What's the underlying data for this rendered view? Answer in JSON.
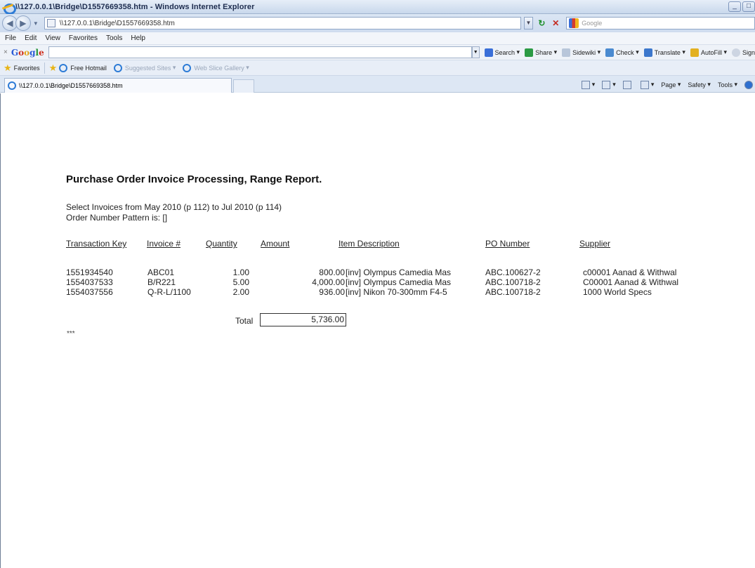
{
  "window": {
    "title": "\\\\127.0.0.1\\Bridge\\D1557669358.htm - Windows Internet Explorer",
    "address": "\\\\127.0.0.1\\Bridge\\D1557669358.htm",
    "search_placeholder": "Google"
  },
  "menu": [
    "File",
    "Edit",
    "View",
    "Favorites",
    "Tools",
    "Help"
  ],
  "google_toolbar": {
    "logo": [
      "G",
      "o",
      "o",
      "g",
      "l",
      "e"
    ],
    "buttons": [
      "Search",
      "Share",
      "Sidewiki",
      "Check",
      "Translate",
      "AutoFill",
      "Sign"
    ]
  },
  "favorites_bar": {
    "favorites_label": "Favorites",
    "links": [
      "Free Hotmail",
      "Suggested Sites",
      "Web Slice Gallery"
    ]
  },
  "tab": {
    "title": "\\\\127.0.0.1\\Bridge\\D1557669358.htm"
  },
  "command_bar": [
    "Page",
    "Safety",
    "Tools"
  ],
  "report": {
    "title": "Purchase Order Invoice Processing, Range Report.",
    "select_line": "Select Invoices from May 2010 (p 112) to Jul 2010 (p 114)",
    "pattern_line": "Order Number Pattern is: []",
    "headers": [
      "Transaction Key",
      "Invoice #",
      "Quantity",
      "Amount",
      "Item Description",
      "PO Number",
      "Supplier"
    ],
    "rows": [
      [
        "1551934540",
        "ABC01",
        "1.00",
        "800.00",
        "[inv] Olympus Camedia Mas",
        "ABC.100627-2",
        "c00001 Aanad & Withwal"
      ],
      [
        "1554037533",
        "B/R221",
        "5.00",
        "4,000.00",
        "[inv] Olympus Camedia Mas",
        "ABC.100718-2",
        "C00001 Aanad & Withwal"
      ],
      [
        "1554037556",
        "Q-R-L/1100",
        "2.00",
        "936.00",
        "[inv] Nikon 70-300mm F4-5",
        "ABC.100718-2",
        "1000 World Specs"
      ]
    ],
    "total_label": "Total",
    "total_value": "5,736.00",
    "end_marker": "***"
  }
}
